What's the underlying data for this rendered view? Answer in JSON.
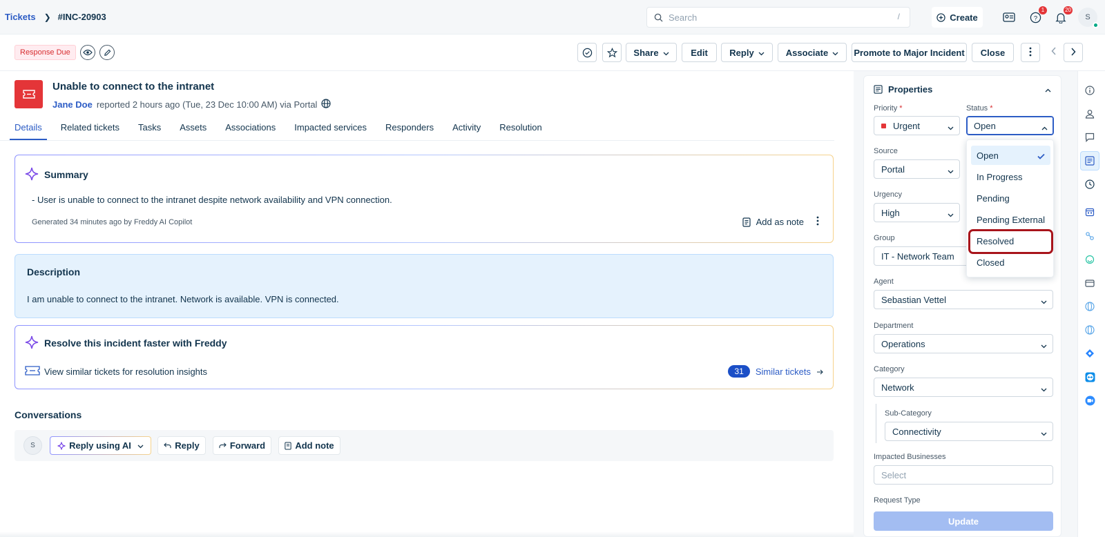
{
  "breadcrumb": {
    "root": "Tickets",
    "ticket_id": "#INC-20903"
  },
  "search": {
    "placeholder": "Search",
    "shortcut": "/"
  },
  "topbar": {
    "create_label": "Create",
    "help_badge": "1",
    "notifications_badge": "20",
    "avatar_initial": "S"
  },
  "actionbar": {
    "status_tag": "Response Due",
    "share": "Share",
    "edit": "Edit",
    "reply": "Reply",
    "associate": "Associate",
    "promote": "Promote to Major Incident",
    "close": "Close"
  },
  "ticket": {
    "title": "Unable to connect to the intranet",
    "author": "Jane Doe",
    "meta": "reported 2 hours ago (Tue, 23 Dec 10:00 AM) via Portal"
  },
  "tabs": [
    "Details",
    "Related tickets",
    "Tasks",
    "Assets",
    "Associations",
    "Impacted services",
    "Responders",
    "Activity",
    "Resolution"
  ],
  "summary": {
    "title": "Summary",
    "text": "- User is unable to connect to the intranet despite network availability and VPN connection.",
    "generated": "Generated 34 minutes ago by Freddy AI Copilot",
    "add_note": "Add as note"
  },
  "description": {
    "title": "Description",
    "text": "I am unable to connect to the intranet. Network is available. VPN is connected."
  },
  "freddy": {
    "title": "Resolve this incident faster with Freddy",
    "text": "View similar tickets for resolution insights",
    "count": "31",
    "link": "Similar tickets"
  },
  "conversations": {
    "title": "Conversations",
    "avatar": "S",
    "reply_ai": "Reply using AI",
    "reply": "Reply",
    "forward": "Forward",
    "add_note": "Add note"
  },
  "properties": {
    "title": "Properties",
    "priority_label": "Priority",
    "priority_value": "Urgent",
    "status_label": "Status",
    "status_value": "Open",
    "source_label": "Source",
    "source_value": "Portal",
    "urgency_label": "Urgency",
    "urgency_value": "High",
    "group_label": "Group",
    "group_value": "IT - Network Team",
    "agent_label": "Agent",
    "agent_value": "Sebastian Vettel",
    "department_label": "Department",
    "department_value": "Operations",
    "category_label": "Category",
    "category_value": "Network",
    "subcategory_label": "Sub-Category",
    "subcategory_value": "Connectivity",
    "impacted_label": "Impacted Businesses",
    "impacted_placeholder": "Select",
    "request_type_label": "Request Type",
    "update": "Update"
  },
  "status_options": [
    "Open",
    "In Progress",
    "Pending",
    "Pending External",
    "Resolved",
    "Closed"
  ],
  "colors": {
    "accent": "#2c5cc5",
    "urgent": "#e43538",
    "highlight": "#a8141b"
  }
}
